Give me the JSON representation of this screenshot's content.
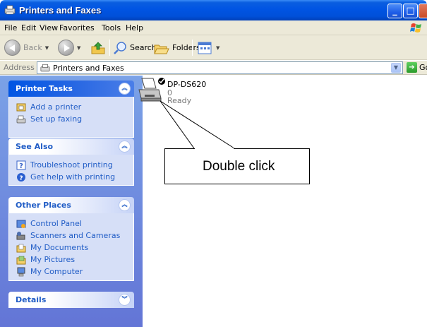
{
  "window": {
    "title": "Printers and Faxes"
  },
  "menu": [
    "File",
    "Edit",
    "View",
    "Favorites",
    "Tools",
    "Help"
  ],
  "toolbar": {
    "back_label": "Back",
    "search_label": "Search",
    "folders_label": "Folders"
  },
  "address": {
    "label": "Address",
    "value": "Printers and Faxes",
    "go_label": "Go"
  },
  "panels": {
    "printer_tasks": {
      "title": "Printer Tasks",
      "items": [
        "Add a printer",
        "Set up faxing"
      ]
    },
    "see_also": {
      "title": "See Also",
      "items": [
        "Troubleshoot printing",
        "Get help with printing"
      ]
    },
    "other_places": {
      "title": "Other Places",
      "items": [
        "Control Panel",
        "Scanners and Cameras",
        "My Documents",
        "My Pictures",
        "My Computer"
      ]
    },
    "details": {
      "title": "Details"
    }
  },
  "printer": {
    "name": "DP-DS620",
    "documents": "0",
    "status": "Ready"
  },
  "callout": {
    "text": "Double click"
  },
  "colors": {
    "titlebar": "#0054e3",
    "taskpane": "#7ba2e7",
    "link": "#215dc6"
  }
}
